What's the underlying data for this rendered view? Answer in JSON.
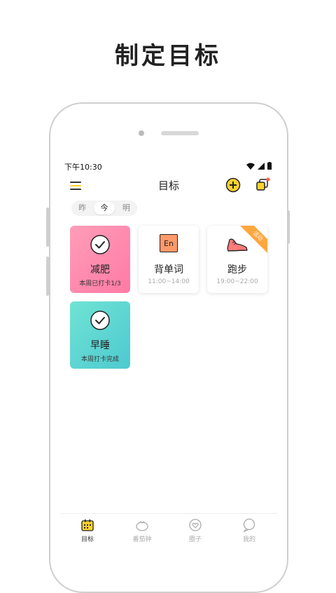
{
  "headline": "制定目标",
  "status": {
    "time": "下午10:30"
  },
  "nav": {
    "title": "目标"
  },
  "day_tabs": [
    "昨",
    "今",
    "明"
  ],
  "cards": {
    "lose_weight": {
      "title": "减肥",
      "sub": "本周已打卡1/3"
    },
    "vocab": {
      "title": "背单词",
      "sub": "11:00~14:00",
      "icon_text": "En"
    },
    "running": {
      "title": "跑步",
      "sub": "19:00~22:00",
      "ribbon": "活动"
    },
    "early_sleep": {
      "title": "早睡",
      "sub": "本周打卡完成"
    }
  },
  "tabbar": {
    "goals": "目标",
    "pomodoro": "番茄钟",
    "circle": "圈子",
    "me": "我的"
  },
  "colors": {
    "accent_yellow": "#ffd22e",
    "pink": "#ff8fb0",
    "teal": "#5dd6d2",
    "ribbon": "#ffa63d"
  }
}
